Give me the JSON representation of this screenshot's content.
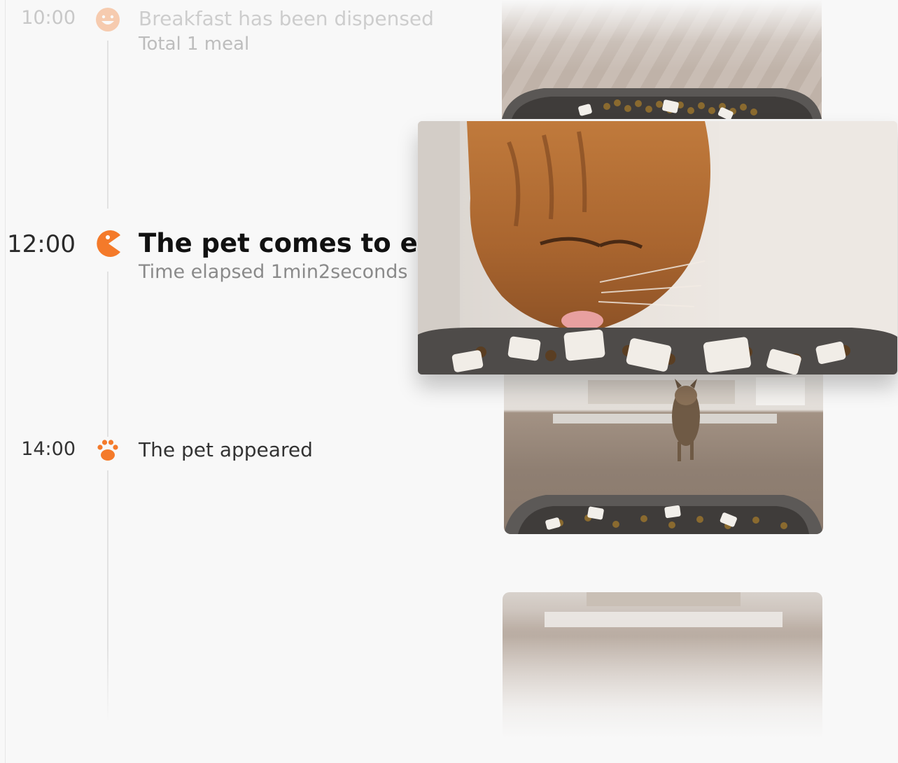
{
  "timeline": {
    "events": [
      {
        "time": "10:00",
        "title": "Breakfast has been dispensed",
        "subtitle": "Total 1 meal",
        "icon": "smile-icon"
      },
      {
        "time": "12:00",
        "title": "The pet comes to eat",
        "subtitle": "Time elapsed 1min2seconds",
        "icon": "pacman-eat-icon"
      },
      {
        "time": "14:00",
        "title": "The pet appeared",
        "subtitle": "",
        "icon": "paw-icon"
      }
    ]
  },
  "colors": {
    "accent": "#F47A2A",
    "background": "#F8F8F8",
    "text_primary": "#111111",
    "text_secondary": "#8A8A8A",
    "text_faded": "#CDCDCD",
    "timeline_line": "#E2E2E2"
  },
  "media": {
    "snapshots": [
      {
        "subject": "food-bowl"
      },
      {
        "subject": "cat-eating"
      },
      {
        "subject": "cat-walking"
      },
      {
        "subject": "floor"
      }
    ]
  }
}
